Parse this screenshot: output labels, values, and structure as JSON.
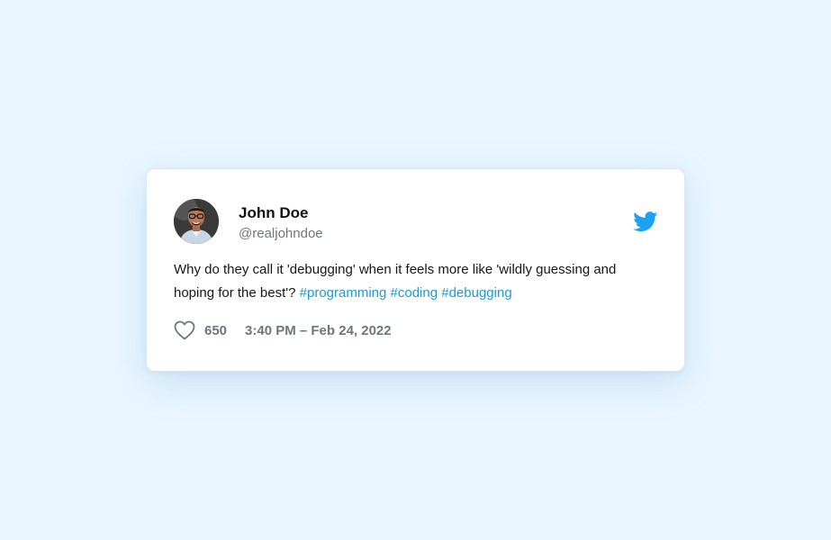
{
  "tweet": {
    "author": {
      "name": "John Doe",
      "handle": "@realjohndoe",
      "avatar_icon": "user-avatar-photo"
    },
    "text_parts": [
      "Why do they call it 'debugging' when it feels more like 'wildly guessing and hoping for the best'?",
      " "
    ],
    "hashtags": [
      "#programming",
      "#coding",
      "#debugging"
    ],
    "likes": "650",
    "timestamp": "3:40 PM – Feb 24, 2022",
    "brand_icon": "twitter-bird-icon",
    "like_icon": "heart-outline-icon"
  },
  "colors": {
    "background": "#e9f6ff",
    "card": "#ffffff",
    "hashtag": "#1d9bd1",
    "twitter_blue": "#1da1f2",
    "muted_text": "#6e767d",
    "primary_text": "#14171a"
  }
}
